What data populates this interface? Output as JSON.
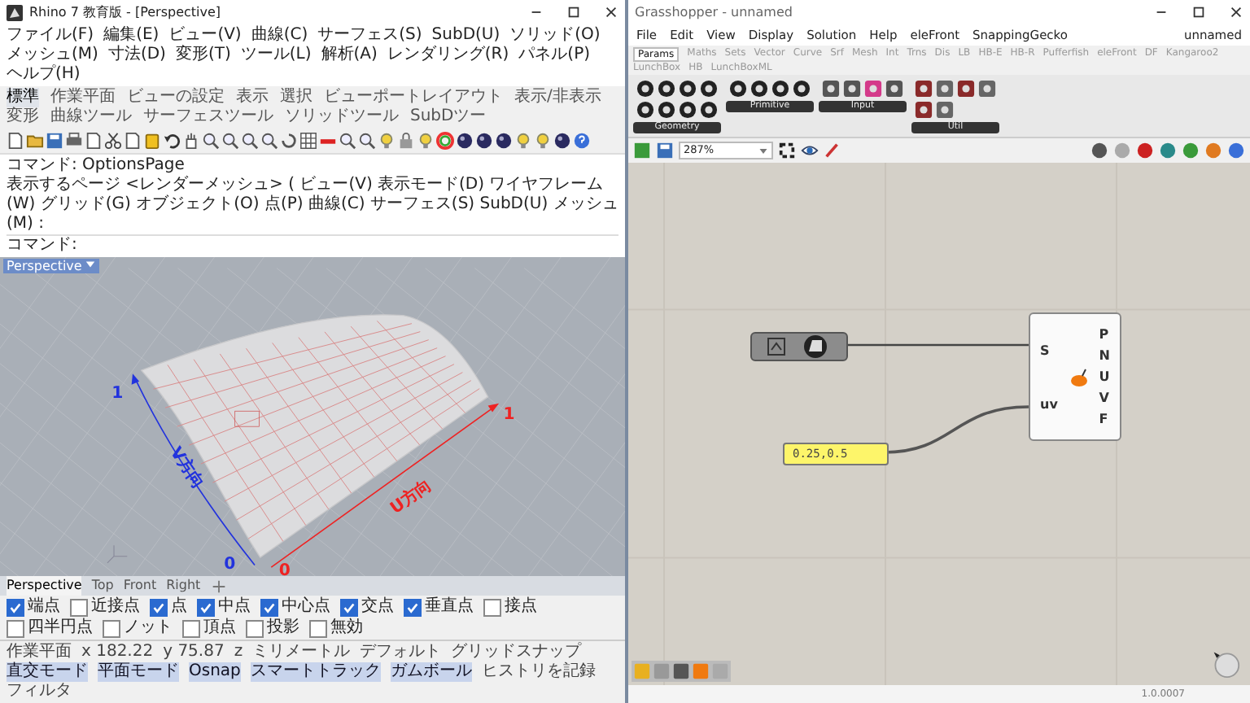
{
  "rhino": {
    "window": {
      "title": "Rhino 7 教育版 - [Perspective]"
    },
    "menu": [
      "ファイル(F)",
      "編集(E)",
      "ビュー(V)",
      "曲線(C)",
      "サーフェス(S)",
      "SubD(U)",
      "ソリッド(O)",
      "メッシュ(M)",
      "寸法(D)",
      "変形(T)",
      "ツール(L)",
      "解析(A)",
      "レンダリング(R)",
      "パネル(P)",
      "ヘルプ(H)"
    ],
    "toolbar_tabs": [
      {
        "label": "標準",
        "selected": true
      },
      {
        "label": "作業平面",
        "selected": false
      },
      {
        "label": "ビューの設定",
        "selected": false
      },
      {
        "label": "表示",
        "selected": false
      },
      {
        "label": "選択",
        "selected": false
      },
      {
        "label": "ビューポートレイアウト",
        "selected": false
      },
      {
        "label": "表示/非表示",
        "selected": false
      },
      {
        "label": "変形",
        "selected": false
      },
      {
        "label": "曲線ツール",
        "selected": false
      },
      {
        "label": "サーフェスツール",
        "selected": false
      },
      {
        "label": "ソリッドツール",
        "selected": false
      },
      {
        "label": "SubDツー",
        "selected": false
      }
    ],
    "command_history": "コマンド: OptionsPage",
    "command_options": "表示するページ <レンダーメッシュ> ( ビュー(V) 表示モード(D) ワイヤフレーム(W) グリッド(G) オブジェクト(O) 点(P) 曲線(C) サーフェス(S) SubD(U) メッシュ(M) :",
    "command_prompt": "コマンド:",
    "viewport": {
      "label": "Perspective",
      "v_max": "1",
      "v_label": "V方向",
      "v_min": "0",
      "u_label": "U方向",
      "u_max": "1",
      "u_min": "0"
    },
    "viewport_tabs": [
      {
        "label": "Perspective",
        "selected": true
      },
      {
        "label": "Top",
        "selected": false
      },
      {
        "label": "Front",
        "selected": false
      },
      {
        "label": "Right",
        "selected": false
      }
    ],
    "osnaps": [
      {
        "label": "端点",
        "checked": true
      },
      {
        "label": "近接点",
        "checked": false
      },
      {
        "label": "点",
        "checked": true
      },
      {
        "label": "中点",
        "checked": true
      },
      {
        "label": "中心点",
        "checked": true
      },
      {
        "label": "交点",
        "checked": true
      },
      {
        "label": "垂直点",
        "checked": true
      },
      {
        "label": "接点",
        "checked": false
      },
      {
        "label": "四半円点",
        "checked": false
      },
      {
        "label": "ノット",
        "checked": false
      },
      {
        "label": "頂点",
        "checked": false
      },
      {
        "label": "投影",
        "checked": false
      },
      {
        "label": "無効",
        "checked": false
      }
    ],
    "status_bar": [
      {
        "text": "作業平面",
        "on": false
      },
      {
        "text": "x 182.22",
        "on": false
      },
      {
        "text": "y 75.87",
        "on": false
      },
      {
        "text": "z",
        "on": false
      },
      {
        "text": "ミリメートル",
        "on": false
      },
      {
        "text": "デフォルト",
        "on": false
      },
      {
        "text": "グリッドスナップ",
        "on": false
      },
      {
        "text": "直交モード",
        "on": true
      },
      {
        "text": "平面モード",
        "on": true
      },
      {
        "text": "Osnap",
        "on": true
      },
      {
        "text": "スマートトラック",
        "on": true
      },
      {
        "text": "ガムボール",
        "on": true
      },
      {
        "text": "ヒストリを記録",
        "on": false
      },
      {
        "text": "フィルタ",
        "on": false
      }
    ]
  },
  "grasshopper": {
    "window": {
      "title": "Grasshopper - unnamed"
    },
    "menu": [
      "File",
      "Edit",
      "View",
      "Display",
      "Solution",
      "Help",
      "eleFront",
      "SnappingGecko"
    ],
    "document_name": "unnamed",
    "tabs": [
      {
        "label": "Params",
        "selected": true
      },
      {
        "label": "Maths",
        "selected": false
      },
      {
        "label": "Sets",
        "selected": false
      },
      {
        "label": "Vector",
        "selected": false
      },
      {
        "label": "Curve",
        "selected": false
      },
      {
        "label": "Srf",
        "selected": false
      },
      {
        "label": "Mesh",
        "selected": false
      },
      {
        "label": "Int",
        "selected": false
      },
      {
        "label": "Trns",
        "selected": false
      },
      {
        "label": "Dis",
        "selected": false
      },
      {
        "label": "LB",
        "selected": false
      },
      {
        "label": "HB-E",
        "selected": false
      },
      {
        "label": "HB-R",
        "selected": false
      },
      {
        "label": "Pufferfish",
        "selected": false
      },
      {
        "label": "eleFront",
        "selected": false
      },
      {
        "label": "DF",
        "selected": false
      },
      {
        "label": "Kangaroo2",
        "selected": false
      },
      {
        "label": "LunchBox",
        "selected": false
      },
      {
        "label": "HB",
        "selected": false
      },
      {
        "label": "LunchBoxML",
        "selected": false
      }
    ],
    "ribbon_groups": [
      {
        "label": "Geometry"
      },
      {
        "label": "Primitive"
      },
      {
        "label": "Input"
      },
      {
        "label": "Util"
      }
    ],
    "zoom": "287%",
    "component": {
      "inputs": [
        "S",
        "uv"
      ],
      "outputs": [
        "P",
        "N",
        "U",
        "V",
        "F"
      ]
    },
    "panel": "0.25,0.5",
    "status": "1.0.0007"
  }
}
